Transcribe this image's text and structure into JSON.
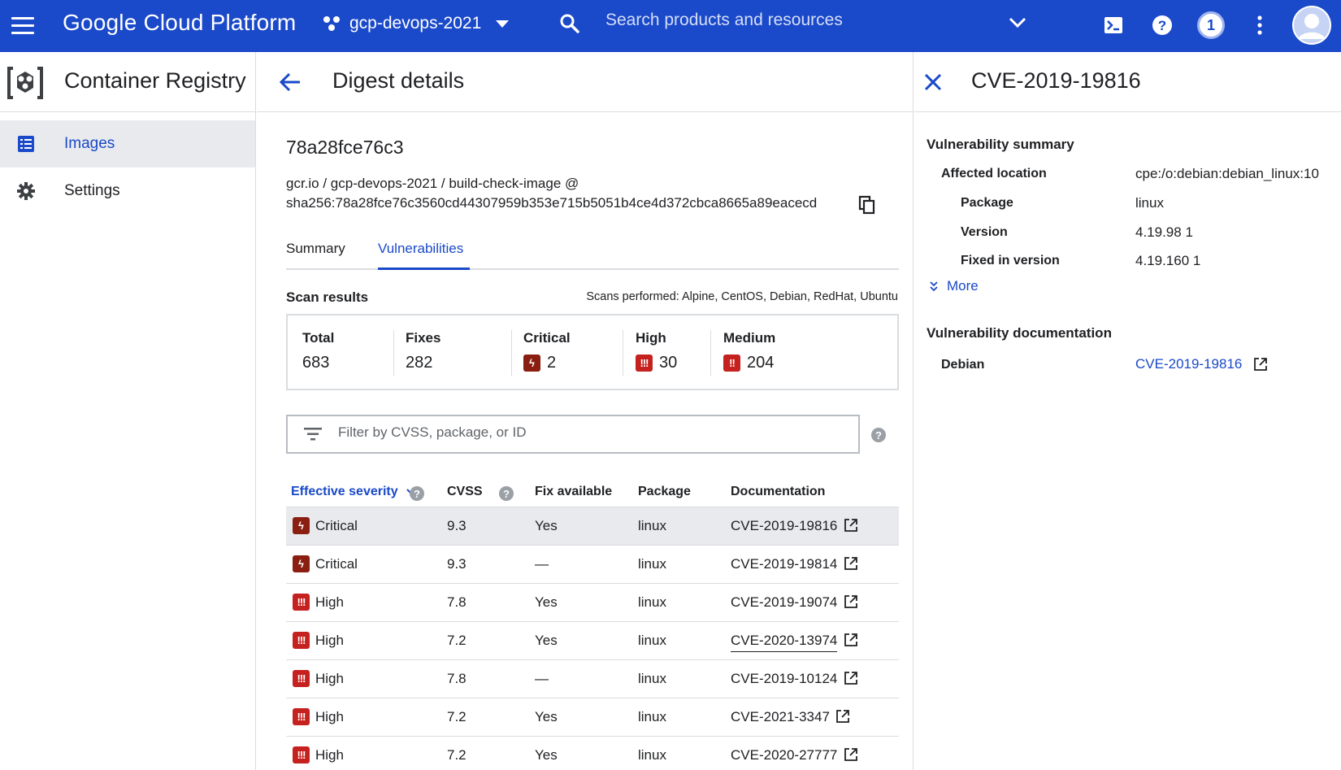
{
  "topbar": {
    "brand": "Google Cloud Platform",
    "project": "gcp-devops-2021",
    "search_placeholder": "Search products and resources",
    "notification_count": "1"
  },
  "sidebar": {
    "title": "Container Registry",
    "items": [
      {
        "label": "Images",
        "icon": "list-icon",
        "active": true
      },
      {
        "label": "Settings",
        "icon": "gear-icon",
        "active": false
      }
    ]
  },
  "digest": {
    "page_title": "Digest details",
    "id": "78a28fce76c3",
    "path_line1": "gcr.io / gcp-devops-2021 / build-check-image @",
    "path_line2": "sha256:78a28fce76c3560cd44307959b353e715b5051b4ce4d372cbca8665a89eacecd",
    "tabs": [
      {
        "label": "Summary",
        "active": false
      },
      {
        "label": "Vulnerabilities",
        "active": true
      }
    ],
    "scan_results_title": "Scan results",
    "scans_performed": "Scans performed: Alpine, CentOS, Debian, RedHat, Ubuntu",
    "stats": {
      "total": {
        "label": "Total",
        "value": "683"
      },
      "fixes": {
        "label": "Fixes",
        "value": "282"
      },
      "critical": {
        "label": "Critical",
        "value": "2"
      },
      "high": {
        "label": "High",
        "value": "30"
      },
      "medium": {
        "label": "Medium",
        "value": "204"
      }
    },
    "filter_placeholder": "Filter by CVSS, package, or ID",
    "columns": {
      "severity": "Effective severity",
      "cvss": "CVSS",
      "fix": "Fix available",
      "package": "Package",
      "documentation": "Documentation"
    },
    "rows": [
      {
        "severity": "Critical",
        "cvss": "9.3",
        "fix": "Yes",
        "package": "linux",
        "doc": "CVE-2019-19816"
      },
      {
        "severity": "Critical",
        "cvss": "9.3",
        "fix": "—",
        "package": "linux",
        "doc": "CVE-2019-19814"
      },
      {
        "severity": "High",
        "cvss": "7.8",
        "fix": "Yes",
        "package": "linux",
        "doc": "CVE-2019-19074"
      },
      {
        "severity": "High",
        "cvss": "7.2",
        "fix": "Yes",
        "package": "linux",
        "doc": "CVE-2020-13974"
      },
      {
        "severity": "High",
        "cvss": "7.8",
        "fix": "—",
        "package": "linux",
        "doc": "CVE-2019-10124"
      },
      {
        "severity": "High",
        "cvss": "7.2",
        "fix": "Yes",
        "package": "linux",
        "doc": "CVE-2021-3347"
      },
      {
        "severity": "High",
        "cvss": "7.2",
        "fix": "Yes",
        "package": "linux",
        "doc": "CVE-2020-27777"
      }
    ]
  },
  "detail": {
    "title": "CVE-2019-19816",
    "summary_heading": "Vulnerability summary",
    "affected_location_label": "Affected location",
    "affected_location_value": "cpe:/o:debian:debian_linux:10",
    "package_label": "Package",
    "package_value": "linux",
    "version_label": "Version",
    "version_value": "4.19.98 1",
    "fixed_label": "Fixed in version",
    "fixed_value": "4.19.160 1",
    "more_label": "More",
    "doc_heading": "Vulnerability documentation",
    "debian_label": "Debian",
    "debian_link": "CVE-2019-19816"
  },
  "colors": {
    "topbar": "#1a49c9",
    "accent": "#1a49c9",
    "critical": "#8a1f11",
    "high": "#c5221f"
  }
}
